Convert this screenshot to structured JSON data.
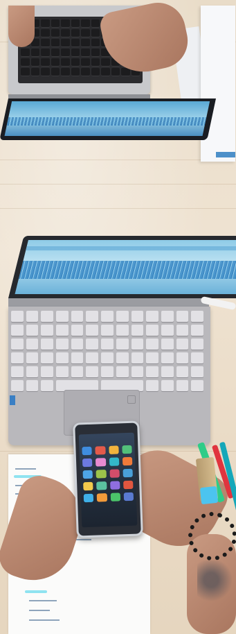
{
  "image": {
    "kind": "photo",
    "subjects": [
      "laptop-keyboard-top",
      "laptop-with-audio-waveform",
      "smartphone",
      "notebook",
      "hands",
      "markers"
    ],
    "colors": {
      "desk": "#e9dcc8",
      "screen_blue": "#8fcbe7",
      "waveform": "#2f7fbf",
      "laptop_silver": "#b9b8bc",
      "highlighter": "#8fe3f0",
      "marker_cap": "#4cc4ef"
    }
  }
}
